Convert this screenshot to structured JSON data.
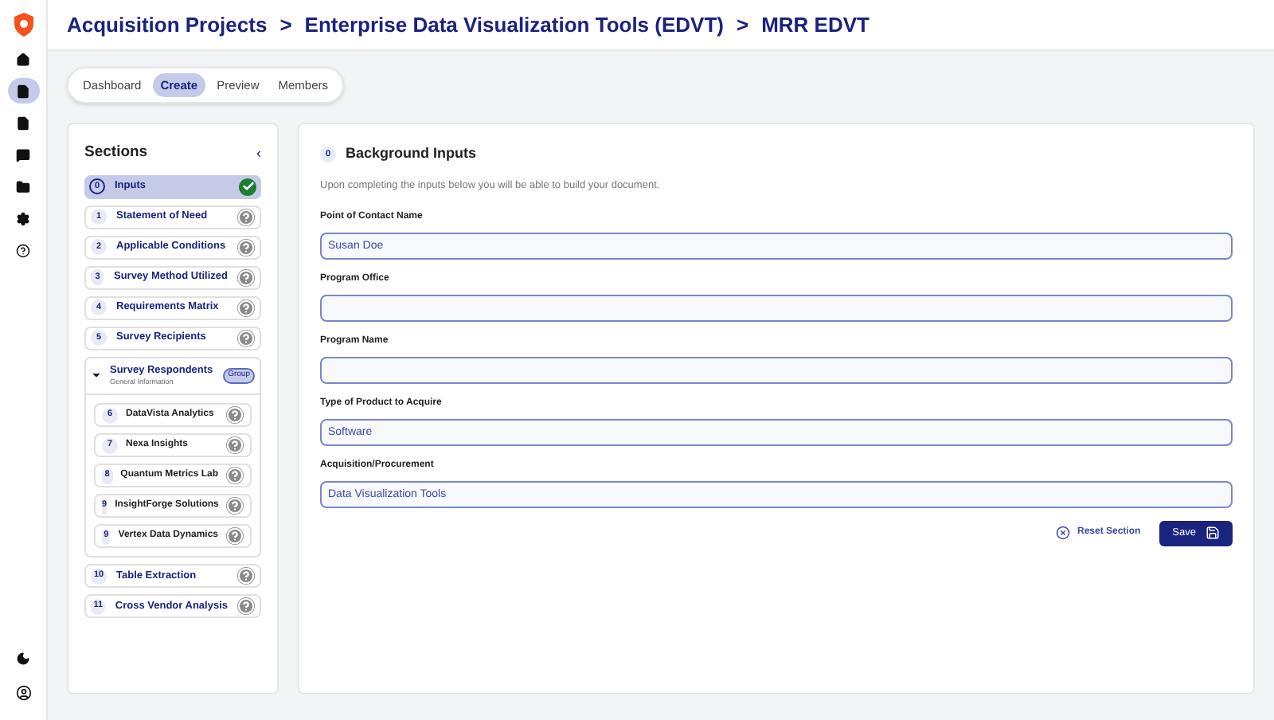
{
  "breadcrumb": [
    "Acquisition Projects",
    "Enterprise Data Visualization Tools (EDVT)",
    "MRR EDVT"
  ],
  "breadcrumb_separator": ">",
  "rail": [
    {
      "selected": false
    },
    {
      "selected": true
    },
    {
      "selected": false
    },
    {
      "selected": false
    },
    {
      "selected": false
    },
    {
      "selected": false
    },
    {
      "selected": false
    }
  ],
  "tabs": [
    {
      "label": "Dashboard",
      "selected": false
    },
    {
      "label": "Create",
      "selected": true
    },
    {
      "label": "Preview",
      "selected": false
    },
    {
      "label": "Members",
      "selected": false
    }
  ],
  "sections": {
    "title": "Sections",
    "collapse_glyph": "‹",
    "items": [
      {
        "kind": "item",
        "number": "0",
        "label": "Inputs",
        "selected": true,
        "complete": true
      },
      {
        "kind": "item",
        "number": "1",
        "label": "Statement of Need",
        "selected": false,
        "complete": false
      },
      {
        "kind": "item",
        "number": "2",
        "label": "Applicable Conditions",
        "selected": false,
        "complete": false
      },
      {
        "kind": "item",
        "number": "3",
        "label": "Survey Method Utilized",
        "selected": false,
        "complete": false
      },
      {
        "kind": "item",
        "number": "4",
        "label": "Requirements Matrix",
        "selected": false,
        "complete": false
      },
      {
        "kind": "item",
        "number": "5",
        "label": "Survey Recipients",
        "selected": false,
        "complete": false
      },
      {
        "kind": "group",
        "label": "Survey Respondents",
        "subtitle": "General Information",
        "badge": "Group",
        "expanded": true,
        "children": [
          {
            "number": "6",
            "label": "DataVista Analytics",
            "complete": false
          },
          {
            "number": "7",
            "label": "Nexa Insights",
            "complete": false
          },
          {
            "number": "8",
            "label": "Quantum Metrics Lab",
            "complete": false
          },
          {
            "number": "9",
            "label": "InsightForge Solutions",
            "complete": false
          },
          {
            "number": "9",
            "label": "Vertex Data Dynamics",
            "complete": false
          }
        ]
      },
      {
        "kind": "item",
        "number": "10",
        "label": "Table Extraction",
        "selected": false,
        "complete": false
      },
      {
        "kind": "item",
        "number": "11",
        "label": "Cross Vendor Analysis",
        "selected": false,
        "complete": false
      }
    ]
  },
  "form": {
    "number": "0",
    "title": "Background Inputs",
    "description": "Upon completing the inputs below you will be able to build your document.",
    "fields": [
      {
        "label": "Point of Contact Name",
        "value": "Susan Doe"
      },
      {
        "label": "Program Office"
      },
      {
        "label": "Program Name"
      },
      {
        "label": "Type of Product to Acquire",
        "value": "Software"
      },
      {
        "label": "Acquisition/Procurement",
        "value": "Data Visualization Tools"
      }
    ],
    "reset_label": "Reset Section",
    "save_label": "Save"
  }
}
